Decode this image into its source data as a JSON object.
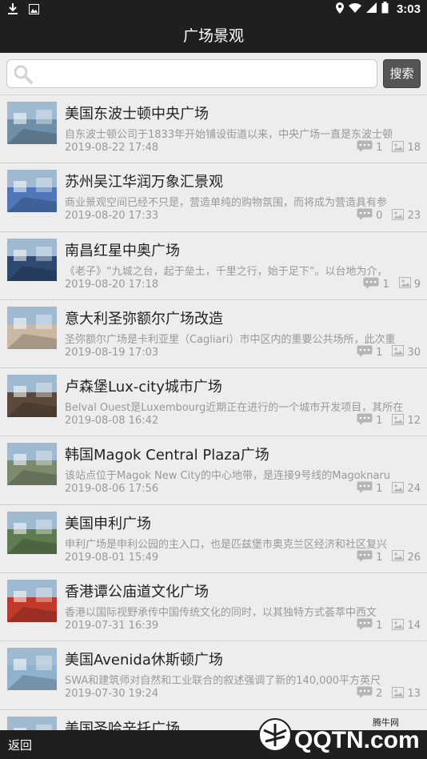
{
  "status": {
    "time": "3:03"
  },
  "header": {
    "title": "广场景观"
  },
  "search": {
    "placeholder": "",
    "button_label": "搜索"
  },
  "items": [
    {
      "title": "美国东波士顿中央广场",
      "summary": "自东波士顿公司于1833年开始铺设街道以来，中央广场一直是东波士顿",
      "date": "2019-08-22 17:48",
      "comments": "1",
      "images": "18",
      "thumb": "#6f8fa8"
    },
    {
      "title": "苏州吴江华润万象汇景观",
      "summary": "商业景观空间已经不只是，营造单纯的购物氛围，而将成为营造具有参",
      "date": "2019-08-20 17:33",
      "comments": "0",
      "images": "23",
      "thumb": "#4f77b9"
    },
    {
      "title": "南昌红星中奥广场",
      "summary": "《老子》“九城之台，起于垒土，千里之行，始于足下”。以台地为介，",
      "date": "2019-08-20 17:18",
      "comments": "1",
      "images": "9",
      "thumb": "#2e4a73"
    },
    {
      "title": "意大利圣弥额尔广场改造",
      "summary": "圣弥额尔广场是卡利亚里（Cagliari）市中区内的重要公共场所，此次重",
      "date": "2019-08-19 17:03",
      "comments": "1",
      "images": "30",
      "thumb": "#c9b9a3"
    },
    {
      "title": "卢森堡Lux-city城市广场",
      "summary": "Belval Ouest是Luxembourg近期正在进行的一个城市开发项目，其所在",
      "date": "2019-08-08 16:42",
      "comments": "1",
      "images": "12",
      "thumb": "#5b4a3c"
    },
    {
      "title": "韩国Magok Central Plaza广场",
      "summary": "该站点位于Magok New City的中心地带，是连接9号线的Magoknaru",
      "date": "2019-08-06 17:56",
      "comments": "1",
      "images": "24",
      "thumb": "#7d8a6e"
    },
    {
      "title": "美国申利广场",
      "summary": "申利广场是申利公园的主入口，也是匹兹堡市奥克兰区经济和社区复兴",
      "date": "2019-08-01 15:49",
      "comments": "1",
      "images": "26",
      "thumb": "#5f7b50"
    },
    {
      "title": "香港谭公庙道文化广场",
      "summary": "香港以国际视野承传中国传统文化的同时，以其独特方式荟萃中西文",
      "date": "2019-07-31 16:39",
      "comments": "1",
      "images": "14",
      "thumb": "#c0392b"
    },
    {
      "title": "美国Avenida休斯顿广场",
      "summary": "SWA和建筑师对自然和工业联合的叙述强调了新的140,000平方英尺",
      "date": "2019-07-30 19:24",
      "comments": "2",
      "images": "13",
      "thumb": "#8fb3cf"
    },
    {
      "title": "美国圣哈辛托广场",
      "summary": "",
      "date": "",
      "comments": "",
      "images": "",
      "thumb": "#3d5f7a"
    }
  ],
  "footer": {
    "back_label": "返回",
    "watermark_text": "QQTN.com",
    "watermark_sub": "腾牛网"
  }
}
